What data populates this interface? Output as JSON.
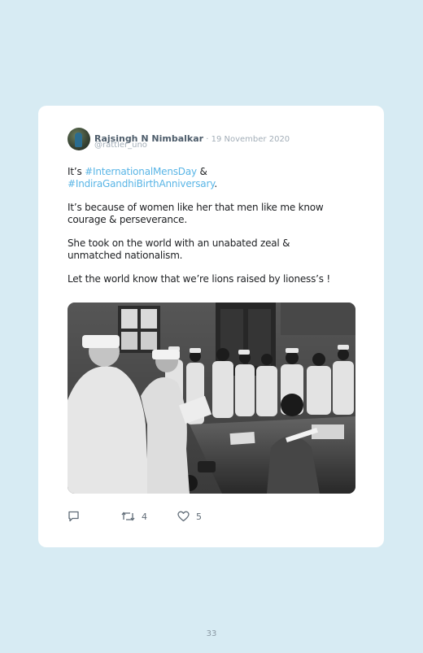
{
  "tweet": {
    "author_name": "Rajsingh N Nimbalkar",
    "date_separator": " · ",
    "date": "19 November 2020",
    "handle": "@rattler_uno",
    "text": {
      "p1_prefix": "It’s ",
      "hashtag_1": "#InternationalMensDay",
      "p1_mid": " &",
      "hashtag_2": "#IndiraGandhiBirthAnniversary",
      "p1_end": ".",
      "p2": "It’s because of women like her that men like me know courage & perseverance.",
      "p3": "She took on the world with an unabated zeal & unmatched nationalism.",
      "p4": "Let the world know that we’re lions raised by lioness’s !"
    },
    "actions": {
      "reply_icon": "reply-icon",
      "retweet_icon": "retweet-icon",
      "retweet_count": "4",
      "like_icon": "heart-icon",
      "like_count": "5"
    }
  },
  "page_number": "33",
  "colors": {
    "page_background": "#d7ebf3",
    "card": "#ffffff",
    "hashtag": "#59b5e6"
  }
}
